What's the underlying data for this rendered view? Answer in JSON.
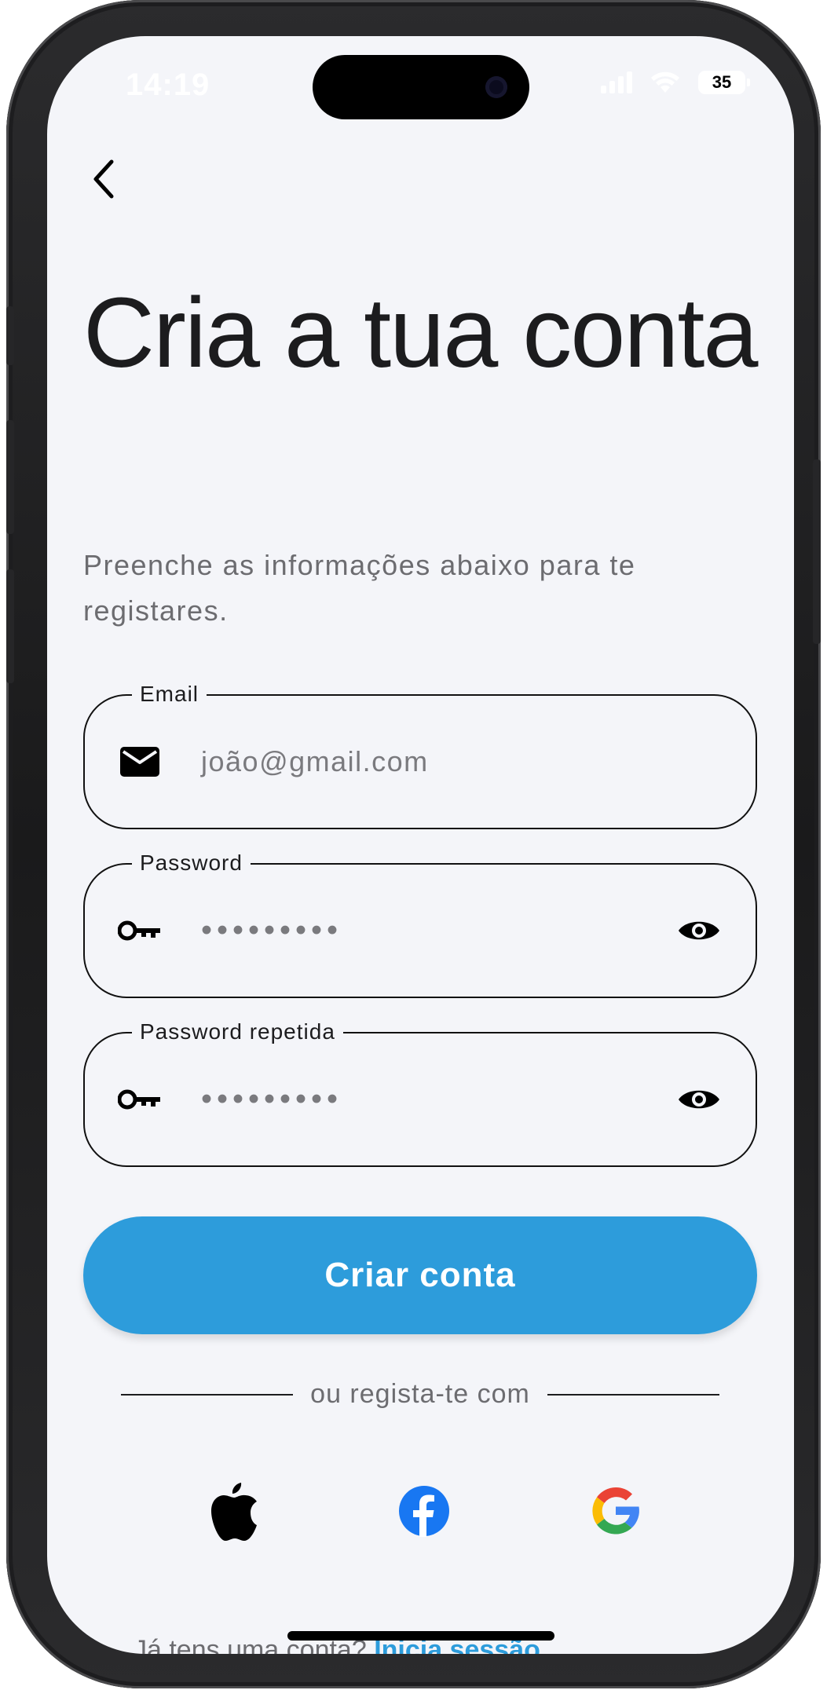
{
  "status_bar": {
    "time": "14:19",
    "battery": "35"
  },
  "header": {
    "back_icon": "chevron-left-icon"
  },
  "title": "Cria a tua conta",
  "subtitle": "Preenche as informações abaixo para te registares.",
  "fields": {
    "email": {
      "label": "Email",
      "placeholder": "joão@gmail.com",
      "icon": "envelope-icon"
    },
    "password": {
      "label": "Password",
      "masked_value": "•••••••••",
      "icon": "key-icon",
      "toggle_icon": "eye-icon"
    },
    "password_repeat": {
      "label": "Password repetida",
      "masked_value": "•••••••••",
      "icon": "key-icon",
      "toggle_icon": "eye-icon"
    }
  },
  "cta": {
    "label": "Criar conta",
    "color": "#2d9cdb"
  },
  "divider": {
    "text": "ou regista-te com"
  },
  "social": [
    {
      "name": "apple",
      "icon": "apple-icon"
    },
    {
      "name": "facebook",
      "icon": "facebook-icon",
      "color": "#1877f2"
    },
    {
      "name": "google",
      "icon": "google-icon"
    }
  ],
  "footer": {
    "prefix": "Já tens uma conta? ",
    "link": "Inicia sessão"
  },
  "colors": {
    "background": "#f4f5f9",
    "accent": "#2d9cdb",
    "text": "#1c1c1e",
    "muted": "#6c6c70"
  }
}
